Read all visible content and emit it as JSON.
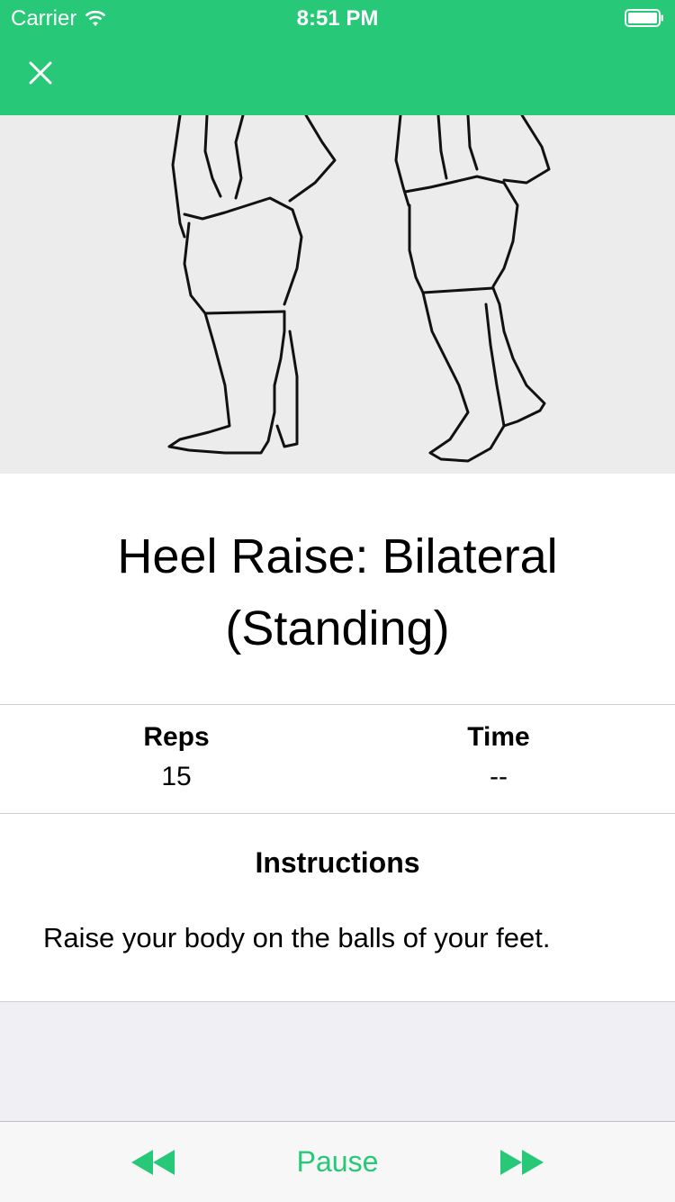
{
  "status_bar": {
    "carrier": "Carrier",
    "time": "8:51 PM"
  },
  "header": {
    "close_icon": "close-icon"
  },
  "exercise": {
    "image_alt": "Illustration of standing heel raise",
    "title": "Heel Raise: Bilateral (Standing)",
    "reps_label": "Reps",
    "reps_value": "15",
    "time_label": "Time",
    "time_value": "--",
    "instructions_heading": "Instructions",
    "instructions_text": "Raise your body on the balls of your feet."
  },
  "toolbar": {
    "previous_icon": "rewind-icon",
    "pause_label": "Pause",
    "next_icon": "fast-forward-icon"
  },
  "colors": {
    "accent": "#27c877",
    "background": "#efeff4",
    "divider": "#cfcfd3"
  }
}
